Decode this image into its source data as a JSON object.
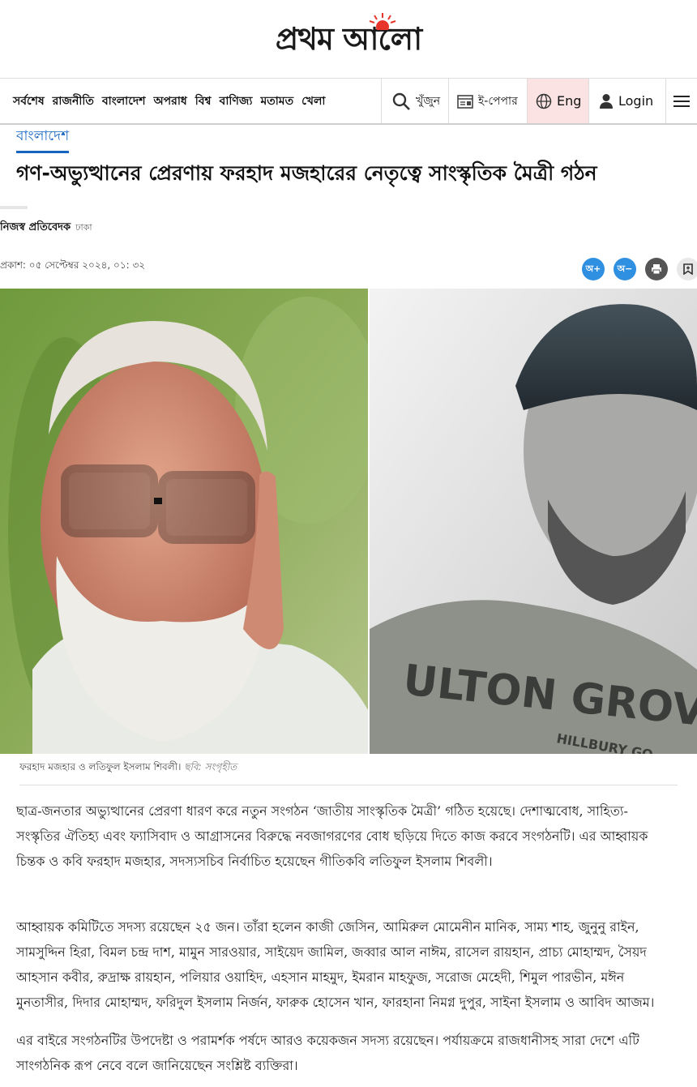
{
  "brand": {
    "logo_text": "প্রথম আলো"
  },
  "nav": {
    "links": [
      "সর্বশেষ",
      "রাজনীতি",
      "বাংলাদেশ",
      "অপরাধ",
      "বিশ্ব",
      "বাণিজ্য",
      "মতামত",
      "খেলা"
    ],
    "search_label": "খুঁজুন",
    "epaper_label": "ই-পেপার",
    "lang_label": "Eng",
    "login_label": "Login"
  },
  "article": {
    "section": "বাংলাদেশ",
    "headline": "গণ-অভ্যুত্থানের প্রেরণায় ফরহাদ মজহারের নেতৃত্বে সাংস্কৃতিক মৈত্রী গঠন",
    "author": "নিজস্ব প্রতিবেদক",
    "location": "ঢাকা",
    "published": "প্রকাশ: ০৫ সেপ্টেম্বর ২০২৪, ০১: ৩২",
    "tools": {
      "font_increase": "অ+",
      "font_decrease": "অ−"
    },
    "caption": "ফরহাদ মজহার ও লতিফুল ইসলাম শিবলী।",
    "caption_credit": "ছবি: সংগৃহীত",
    "paragraphs": [
      "ছাত্র-জনতার অভ্যুত্থানের প্রেরণা ধারণ করে নতুন সংগঠন ‘জাতীয় সাংস্কৃতিক মৈত্রী’ গঠিত হয়েছে। দেশাত্মবোধ, সাহিত্য-সংস্কৃতির ঐতিহ্য এবং ফ্যাসিবাদ ও আগ্রাসনের বিরুদ্ধে নবজাগরণের বোধ ছড়িয়ে দিতে কাজ করবে সংগঠনটি। এর আহ্বায়ক চিন্তক ও কবি ফরহাদ মজহার, সদস্যসচিব নির্বাচিত হয়েছেন গীতিকবি লতিফুল ইসলাম শিবলী।",
      "আহ্বায়ক কমিটিতে সদস্য রয়েছেন ২৫ জন। তাঁরা হলেন কাজী জেসিন, আমিরুল মোমেনীন মানিক, সাম্য শাহ, জুনুনু রাইন, সামসুদ্দিন হিরা, বিমল চন্দ্র দাশ, মামুন সারওয়ার, সাইয়েদ জামিল, জব্বার আল নাঈম, রাসেল রায়হান, প্রাচ্য মোহাম্মদ, সৈয়দ আহসান কবীর, রুদ্রাক্ষ রায়হান, পলিয়ার ওয়াহিদ, এহসান মাহমুদ, ইমরান মাহফুজ, সরোজ মেহেদী, শিমুল পারভীন, মঈন মুনতাসীর, দিদার মোহাম্মদ, ফরিদুল ইসলাম নির্জন, ফারুক হোসেন খান, ফারহানা নিমগ্ন দুপুর, সাইনা ইসলাম ও আবিদ আজম।",
      "এর বাইরে সংগঠনটির উপদেষ্টা ও পরামর্শক পর্ষদে আরও কয়েকজন সদস্য রয়েছেন। পর্যায়ক্রমে রাজধানীসহ সারা দেশে এটি সাংগঠনিক রূপ নেবে বলে জানিয়েছেন সংশ্লিষ্ট ব্যক্তিরা।"
    ]
  },
  "colors": {
    "brand_red": "#e8352b",
    "link_blue": "#1565c0",
    "tool_blue": "#2f8fe0",
    "eng_bg": "#fbe3e3"
  },
  "icons": [
    "sun-logo-icon",
    "search-icon",
    "epaper-icon",
    "globe-icon",
    "user-icon",
    "hamburger-icon",
    "print-icon",
    "bookmark-icon"
  ]
}
